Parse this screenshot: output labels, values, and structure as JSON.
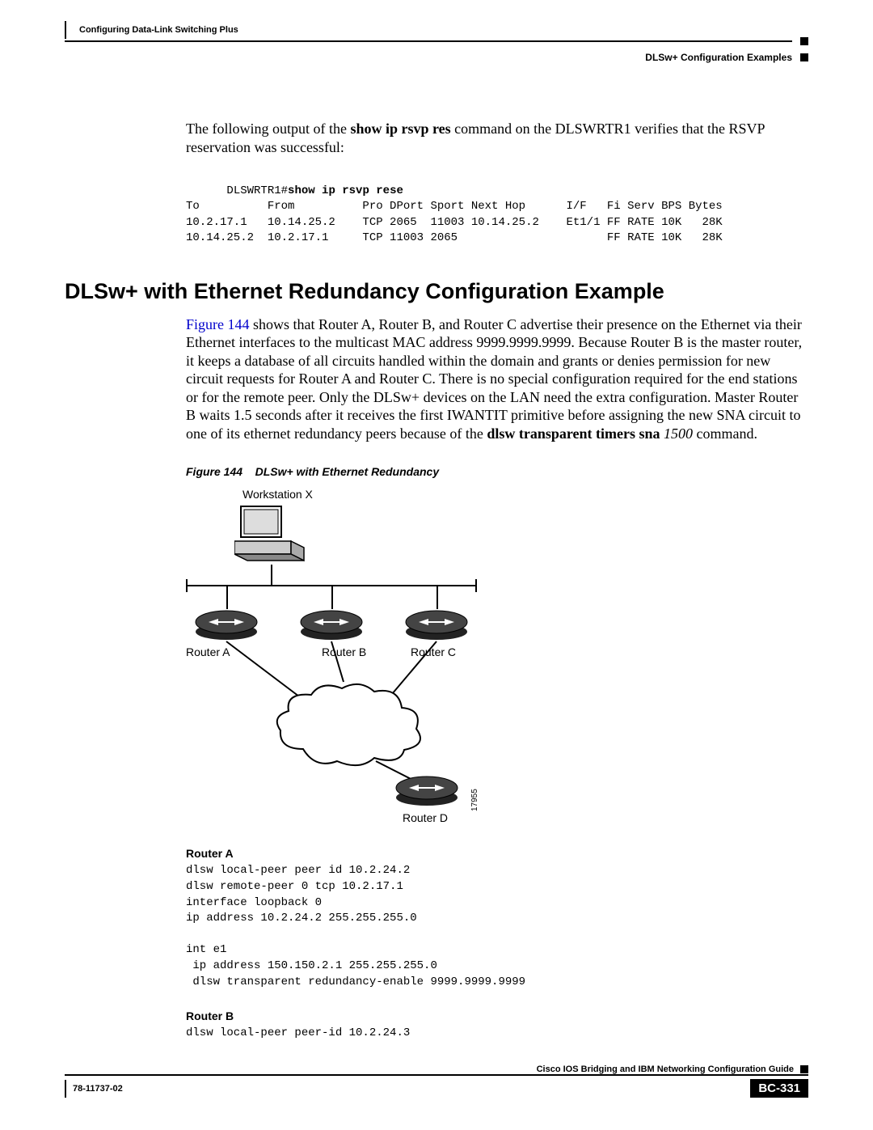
{
  "header": {
    "chapter_title": "Configuring Data-Link Switching Plus",
    "breadcrumb": "DLSw+ Configuration Examples"
  },
  "intro": {
    "prefix": "The following output of the ",
    "cmd_bold": "show ip rsvp res",
    "suffix": " command on the DLSWRTR1 verifies that the RSVP reservation was successful:"
  },
  "cli": {
    "prompt": "DLSWRTR1#",
    "command": "show ip rsvp rese",
    "output": "To          From          Pro DPort Sport Next Hop      I/F   Fi Serv BPS Bytes\n10.2.17.1   10.14.25.2    TCP 2065  11003 10.14.25.2    Et1/1 FF RATE 10K   28K\n10.14.25.2  10.2.17.1     TCP 11003 2065                      FF RATE 10K   28K"
  },
  "section_title": "DLSw+ with Ethernet Redundancy Configuration Example",
  "para": {
    "link_text": "Figure 144",
    "rest1": " shows that Router A, Router B, and Router C advertise their presence on the Ethernet via their Ethernet interfaces to the multicast MAC address 9999.9999.9999. Because Router B is the master router, it keeps a database of all circuits handled within the domain and grants or denies permission for new circuit requests for Router A and Router C. There is no special configuration required for the end stations or for the remote peer. Only the DLSw+ devices on the LAN need the extra configuration. Master Router B waits 1.5 seconds after it receives the first IWANTIT primitive before assigning the new SNA circuit to one of its ethernet redundancy peers because of the ",
    "bold2": "dlsw transparent timers sna",
    "italic2": " 1500",
    "rest2": " command."
  },
  "figure": {
    "caption_prefix": "Figure 144",
    "caption_text": "DLSw+ with Ethernet Redundancy",
    "ws_label": "Workstation X",
    "router_a": "Router A",
    "router_b": "Router B",
    "router_c": "Router C",
    "router_d": "Router D",
    "id": "17955"
  },
  "router_a_cfg": {
    "title": "Router A",
    "code": "dlsw local-peer peer id 10.2.24.2\ndlsw remote-peer 0 tcp 10.2.17.1\ninterface loopback 0\nip address 10.2.24.2 255.255.255.0\n\nint e1\n ip address 150.150.2.1 255.255.255.0\n dlsw transparent redundancy-enable 9999.9999.9999"
  },
  "router_b_cfg": {
    "title": "Router B",
    "code": "dlsw local-peer peer-id 10.2.24.3"
  },
  "footer": {
    "guide": "Cisco IOS Bridging and IBM Networking Configuration Guide",
    "docnum": "78-11737-02",
    "page": "BC-331"
  }
}
